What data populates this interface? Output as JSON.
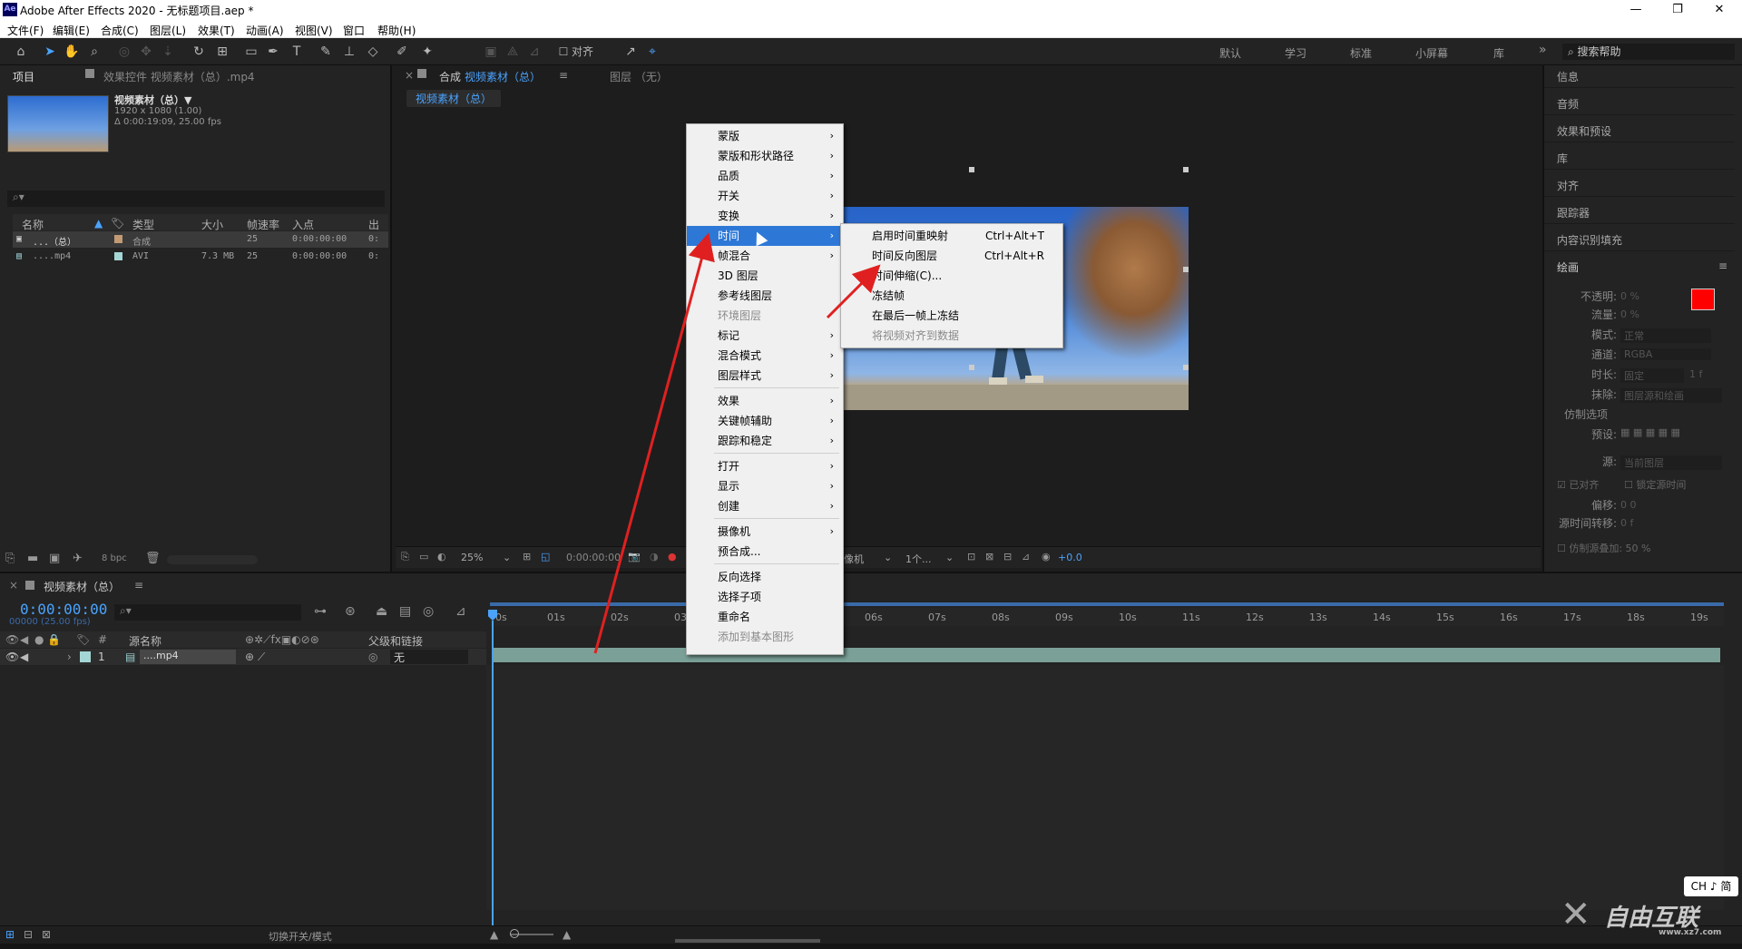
{
  "window": {
    "app_icon": "Ae",
    "title": "Adobe After Effects 2020 - 无标题项目.aep *",
    "minimize": "—",
    "maximize": "❐",
    "close": "✕"
  },
  "menubar": [
    "文件(F)",
    "编辑(E)",
    "合成(C)",
    "图层(L)",
    "效果(T)",
    "动画(A)",
    "视图(V)",
    "窗口",
    "帮助(H)"
  ],
  "toolbar": {
    "align_label": "对齐",
    "workspaces": [
      "默认",
      "学习",
      "标准",
      "小屏幕",
      "库"
    ],
    "more": "»",
    "search_placeholder": "搜索帮助"
  },
  "project_panel": {
    "tab_project": "项目",
    "tab_effects": "效果控件 视频素材（总）.mp4",
    "asset_name": "视频素材（总）▼",
    "asset_dims": "1920 x 1080 (1.00)",
    "asset_duration": "Δ 0:00:19:09, 25.00 fps",
    "columns": [
      "名称",
      "类型",
      "大小",
      "帧速率",
      "入点",
      "出点"
    ],
    "rows": [
      {
        "name": "...（总）",
        "type": "合成",
        "size": "",
        "fps": "25",
        "in": "0:00:00:00",
        "out": "0:"
      },
      {
        "name": "....mp4",
        "type": "AVI",
        "size": "7.3 MB",
        "fps": "25",
        "in": "0:00:00:00",
        "out": "0:"
      }
    ],
    "bpc": "8 bpc"
  },
  "viewer": {
    "tab_comp_prefix": "合成",
    "tab_comp_name": "视频素材（总）",
    "tab_layer": "图层 （无）",
    "comp_breadcrumb": "视频素材（总）",
    "zoom": "25%",
    "timecode": "0:00:00:00",
    "camera": "像机",
    "views": "1个...",
    "exposure": "+0.0"
  },
  "right_panel": {
    "items": [
      "信息",
      "音频",
      "效果和预设",
      "库",
      "对齐",
      "跟踪器",
      "内容识别填充"
    ],
    "paint_title": "绘画",
    "paint_labels": [
      "不透明:",
      "流量:",
      "模式:",
      "通道:",
      "时长:",
      "抹除:",
      "仿制选项",
      "预设:",
      "源:",
      "已对齐",
      "锁定源时间",
      "偏移:",
      "源时间转移:",
      "仿制源叠加: 50 %"
    ],
    "paint_values": [
      "0 %",
      "0 %",
      "正常",
      "RGBA",
      "固定",
      "图层源和绘画",
      "当前图层",
      "0 0",
      "0 f",
      "1 f"
    ],
    "fg_color": "#ff0000",
    "bg_color": "#ffffff"
  },
  "timeline": {
    "tab_name": "视频素材（总）",
    "timecode": "0:00:00:00",
    "fps_note": "00000 (25.00 fps)",
    "columns": [
      "#",
      "源名称",
      "父级和链接"
    ],
    "layer": {
      "num": "1",
      "name": "....mp4",
      "parent": "无"
    },
    "ruler": [
      "0s",
      "01s",
      "02s",
      "03s",
      "06s",
      "07s",
      "08s",
      "09s",
      "10s",
      "11s",
      "12s",
      "13s",
      "14s",
      "15s",
      "16s",
      "17s",
      "18s",
      "19s"
    ],
    "toggle_mode": "切换开关/模式"
  },
  "context_menu": {
    "items": [
      {
        "label": "蒙版",
        "arrow": true
      },
      {
        "label": "蒙版和形状路径",
        "arrow": true
      },
      {
        "label": "品质",
        "arrow": true
      },
      {
        "label": "开关",
        "arrow": true
      },
      {
        "label": "变换",
        "arrow": true
      },
      {
        "label": "时间",
        "arrow": true,
        "highlighted": true
      },
      {
        "label": "帧混合",
        "arrow": true
      },
      {
        "label": "3D 图层",
        "arrow": false
      },
      {
        "label": "参考线图层",
        "arrow": false
      },
      {
        "label": "环境图层",
        "arrow": false,
        "disabled": true
      },
      {
        "label": "标记",
        "arrow": true
      },
      {
        "label": "混合模式",
        "arrow": true
      },
      {
        "label": "图层样式",
        "arrow": true
      },
      {
        "label": "效果",
        "arrow": true
      },
      {
        "label": "关键帧辅助",
        "arrow": true
      },
      {
        "label": "跟踪和稳定",
        "arrow": true
      },
      {
        "label": "打开",
        "arrow": true
      },
      {
        "label": "显示",
        "arrow": true
      },
      {
        "label": "创建",
        "arrow": true
      },
      {
        "label": "摄像机",
        "arrow": true
      },
      {
        "label": "预合成...",
        "arrow": false
      },
      {
        "label": "反向选择",
        "arrow": false
      },
      {
        "label": "选择子项",
        "arrow": false
      },
      {
        "label": "重命名",
        "arrow": false
      },
      {
        "label": "添加到基本图形",
        "arrow": false,
        "disabled": true
      }
    ]
  },
  "submenu": {
    "items": [
      {
        "label": "启用时间重映射",
        "shortcut": "Ctrl+Alt+T"
      },
      {
        "label": "时间反向图层",
        "shortcut": "Ctrl+Alt+R"
      },
      {
        "label": "时间伸缩(C)...",
        "shortcut": ""
      },
      {
        "label": "冻结帧",
        "shortcut": ""
      },
      {
        "label": "在最后一帧上冻结",
        "shortcut": ""
      },
      {
        "label": "将视频对齐到数据",
        "shortcut": "",
        "disabled": true
      }
    ]
  },
  "ime_indicator": "CH ♪ 简",
  "watermark": {
    "brand": "自由互联",
    "url": "www.xz7.com"
  }
}
